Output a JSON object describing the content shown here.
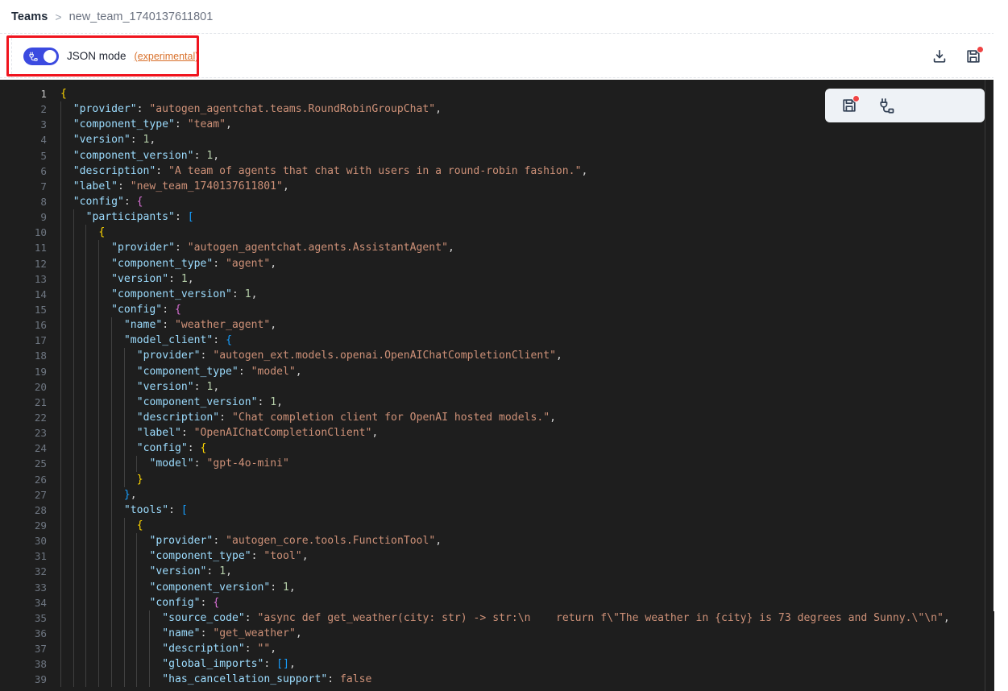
{
  "breadcrumb": {
    "root": "Teams",
    "separator": ">",
    "current": "new_team_1740137611801"
  },
  "toolbar": {
    "json_mode_label": "JSON mode",
    "experimental_label": "(experimental)",
    "toggle_state": "on",
    "toggle_icon": "plug-connector-icon",
    "download_icon": "download-icon",
    "save_icon": "save-floppy-icon",
    "save_has_unsaved_badge": true,
    "accent_color": "#3b4ae0",
    "experimental_link_color": "#d9702a",
    "badge_color": "#ef4444",
    "annotation_color": "#f0141e"
  },
  "editor_toolbar": {
    "save_icon": "save-floppy-icon",
    "save_has_unsaved_badge": true,
    "test_icon": "plug-connector-icon"
  },
  "editor": {
    "language": "json",
    "theme": "vs-dark",
    "background": "#1e1e1e",
    "active_line": 1,
    "first_line": 1,
    "last_visible_line": 39,
    "lines": [
      {
        "no": 1,
        "guides": 0,
        "text": "{"
      },
      {
        "no": 2,
        "guides": 1,
        "text": "  \"provider\": \"autogen_agentchat.teams.RoundRobinGroupChat\","
      },
      {
        "no": 3,
        "guides": 1,
        "text": "  \"component_type\": \"team\","
      },
      {
        "no": 4,
        "guides": 1,
        "text": "  \"version\": 1,"
      },
      {
        "no": 5,
        "guides": 1,
        "text": "  \"component_version\": 1,"
      },
      {
        "no": 6,
        "guides": 1,
        "text": "  \"description\": \"A team of agents that chat with users in a round-robin fashion.\","
      },
      {
        "no": 7,
        "guides": 1,
        "text": "  \"label\": \"new_team_1740137611801\","
      },
      {
        "no": 8,
        "guides": 1,
        "text": "  \"config\": {"
      },
      {
        "no": 9,
        "guides": 2,
        "text": "    \"participants\": ["
      },
      {
        "no": 10,
        "guides": 3,
        "text": "      {"
      },
      {
        "no": 11,
        "guides": 4,
        "text": "        \"provider\": \"autogen_agentchat.agents.AssistantAgent\","
      },
      {
        "no": 12,
        "guides": 4,
        "text": "        \"component_type\": \"agent\","
      },
      {
        "no": 13,
        "guides": 4,
        "text": "        \"version\": 1,"
      },
      {
        "no": 14,
        "guides": 4,
        "text": "        \"component_version\": 1,"
      },
      {
        "no": 15,
        "guides": 4,
        "text": "        \"config\": {"
      },
      {
        "no": 16,
        "guides": 5,
        "text": "          \"name\": \"weather_agent\","
      },
      {
        "no": 17,
        "guides": 5,
        "text": "          \"model_client\": {"
      },
      {
        "no": 18,
        "guides": 6,
        "text": "            \"provider\": \"autogen_ext.models.openai.OpenAIChatCompletionClient\","
      },
      {
        "no": 19,
        "guides": 6,
        "text": "            \"component_type\": \"model\","
      },
      {
        "no": 20,
        "guides": 6,
        "text": "            \"version\": 1,"
      },
      {
        "no": 21,
        "guides": 6,
        "text": "            \"component_version\": 1,"
      },
      {
        "no": 22,
        "guides": 6,
        "text": "            \"description\": \"Chat completion client for OpenAI hosted models.\","
      },
      {
        "no": 23,
        "guides": 6,
        "text": "            \"label\": \"OpenAIChatCompletionClient\","
      },
      {
        "no": 24,
        "guides": 6,
        "text": "            \"config\": {"
      },
      {
        "no": 25,
        "guides": 7,
        "text": "              \"model\": \"gpt-4o-mini\""
      },
      {
        "no": 26,
        "guides": 6,
        "text": "            }"
      },
      {
        "no": 27,
        "guides": 5,
        "text": "          },"
      },
      {
        "no": 28,
        "guides": 5,
        "text": "          \"tools\": ["
      },
      {
        "no": 29,
        "guides": 6,
        "text": "            {"
      },
      {
        "no": 30,
        "guides": 7,
        "text": "              \"provider\": \"autogen_core.tools.FunctionTool\","
      },
      {
        "no": 31,
        "guides": 7,
        "text": "              \"component_type\": \"tool\","
      },
      {
        "no": 32,
        "guides": 7,
        "text": "              \"version\": 1,"
      },
      {
        "no": 33,
        "guides": 7,
        "text": "              \"component_version\": 1,"
      },
      {
        "no": 34,
        "guides": 7,
        "text": "              \"config\": {"
      },
      {
        "no": 35,
        "guides": 8,
        "text": "                \"source_code\": \"async def get_weather(city: str) -> str:\\n    return f\\\"The weather in {city} is 73 degrees and Sunny.\\\"\\n\","
      },
      {
        "no": 36,
        "guides": 8,
        "text": "                \"name\": \"get_weather\","
      },
      {
        "no": 37,
        "guides": 8,
        "text": "                \"description\": \"\","
      },
      {
        "no": 38,
        "guides": 8,
        "text": "                \"global_imports\": [],"
      },
      {
        "no": 39,
        "guides": 8,
        "text": "                \"has_cancellation_support\": false"
      }
    ]
  }
}
